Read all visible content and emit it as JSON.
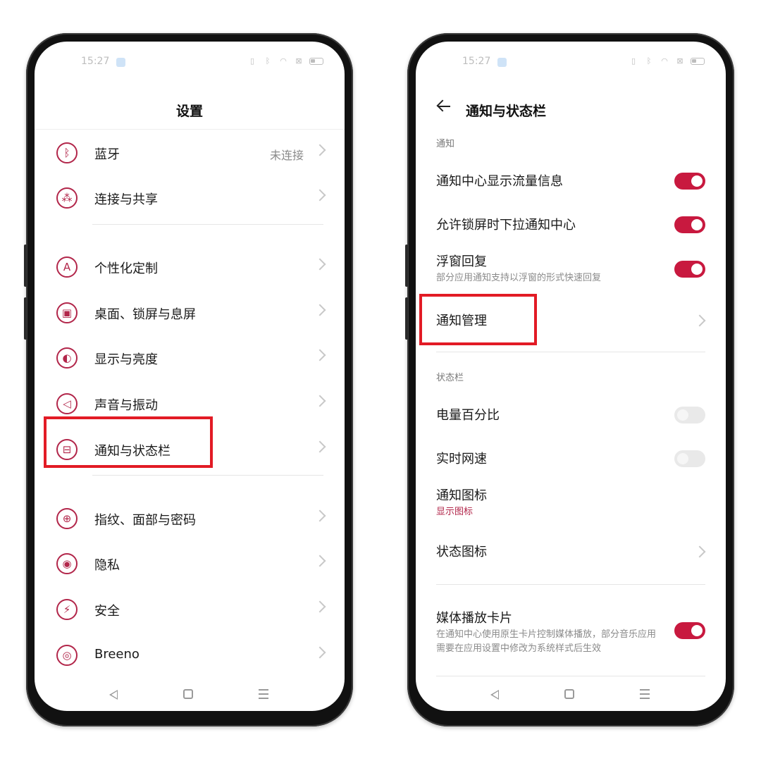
{
  "status": {
    "time": "15:27"
  },
  "left": {
    "title": "设置",
    "items": [
      {
        "label": "蓝牙",
        "value": "未连接",
        "icon": "bluetooth-icon"
      },
      {
        "label": "连接与共享",
        "icon": "share-icon"
      },
      {
        "label": "个性化定制",
        "icon": "personalize-icon"
      },
      {
        "label": "桌面、锁屏与息屏",
        "icon": "wallpaper-icon"
      },
      {
        "label": "显示与亮度",
        "icon": "brightness-icon"
      },
      {
        "label": "声音与振动",
        "icon": "sound-icon"
      },
      {
        "label": "通知与状态栏",
        "icon": "notification-icon"
      },
      {
        "label": "指纹、面部与密码",
        "icon": "lock-icon"
      },
      {
        "label": "隐私",
        "icon": "privacy-eye-icon"
      },
      {
        "label": "安全",
        "icon": "shield-icon"
      },
      {
        "label": "Breeno",
        "icon": "breeno-icon"
      }
    ]
  },
  "right": {
    "title": "通知与状态栏",
    "section_notify": "通知",
    "section_statusbar": "状态栏",
    "items": {
      "flow_info": {
        "label": "通知中心显示流量信息",
        "on": true
      },
      "lockscreen_pull": {
        "label": "允许锁屏时下拉通知中心",
        "on": true
      },
      "float_reply": {
        "label": "浮窗回复",
        "sub": "部分应用通知支持以浮窗的形式快速回复",
        "on": true
      },
      "notify_manage": {
        "label": "通知管理"
      },
      "battery_percent": {
        "label": "电量百分比",
        "on": false
      },
      "net_speed": {
        "label": "实时网速",
        "on": false
      },
      "notify_icon": {
        "label": "通知图标",
        "sub": "显示图标"
      },
      "status_icon": {
        "label": "状态图标"
      },
      "media_card": {
        "label": "媒体播放卡片",
        "sub": "在通知中心使用原生卡片控制媒体播放，部分音乐应用需要在应用设置中修改为系统样式后生效",
        "on": true
      }
    }
  },
  "colors": {
    "accent": "#c8193f",
    "highlight": "#e21b25",
    "icon": "#b2264a"
  }
}
